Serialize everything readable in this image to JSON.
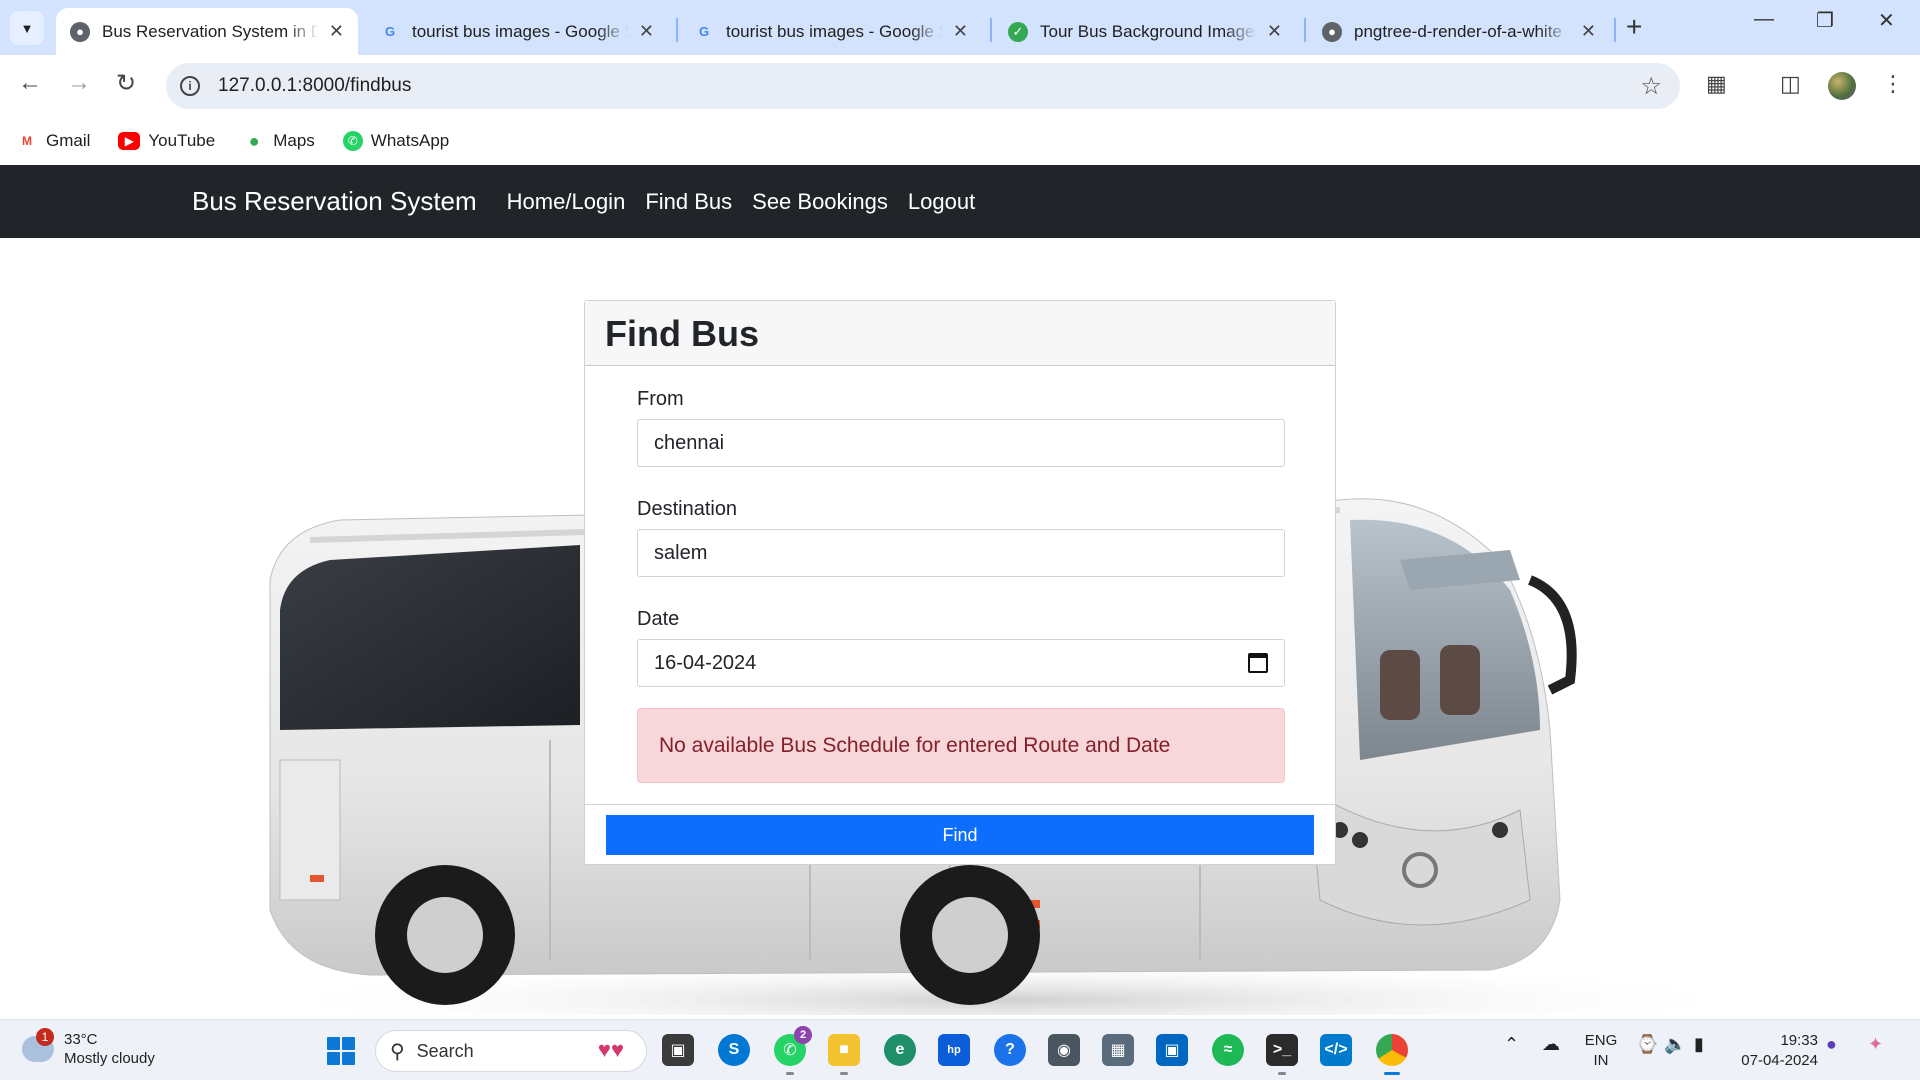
{
  "browser": {
    "tabs": [
      {
        "title": "Bus Reservation System in Dja",
        "active": true
      },
      {
        "title": "tourist bus images - Google S",
        "active": false
      },
      {
        "title": "tourist bus images - Google S",
        "active": false
      },
      {
        "title": "Tour Bus Background Images",
        "active": false
      },
      {
        "title": "pngtree-d-render-of-a-white",
        "active": false
      }
    ],
    "url": "127.0.0.1:8000/findbus",
    "bookmarks": [
      "Gmail",
      "YouTube",
      "Maps",
      "WhatsApp"
    ]
  },
  "navbar": {
    "brand": "Bus Reservation System",
    "links": [
      "Home/Login",
      "Find Bus",
      "See Bookings",
      "Logout"
    ]
  },
  "form": {
    "title": "Find Bus",
    "from_label": "From",
    "from_value": "chennai",
    "destination_label": "Destination",
    "destination_value": "salem",
    "date_label": "Date",
    "date_value": "16-04-2024",
    "alert": "No available Bus Schedule for entered Route and Date",
    "submit_label": "Find"
  },
  "taskbar": {
    "weather_temp": "33°C",
    "weather_desc": "Mostly cloudy",
    "weather_badge": "1",
    "search_placeholder": "Search",
    "whatsapp_badge": "2",
    "lang_top": "ENG",
    "lang_bottom": "IN",
    "time": "19:33",
    "date": "07-04-2024"
  },
  "colors": {
    "navbar_bg": "#212529",
    "primary": "#0d6efd",
    "alert_bg": "#f8d7da",
    "alert_text": "#842029",
    "tabstrip_bg": "#d3e3fd"
  }
}
